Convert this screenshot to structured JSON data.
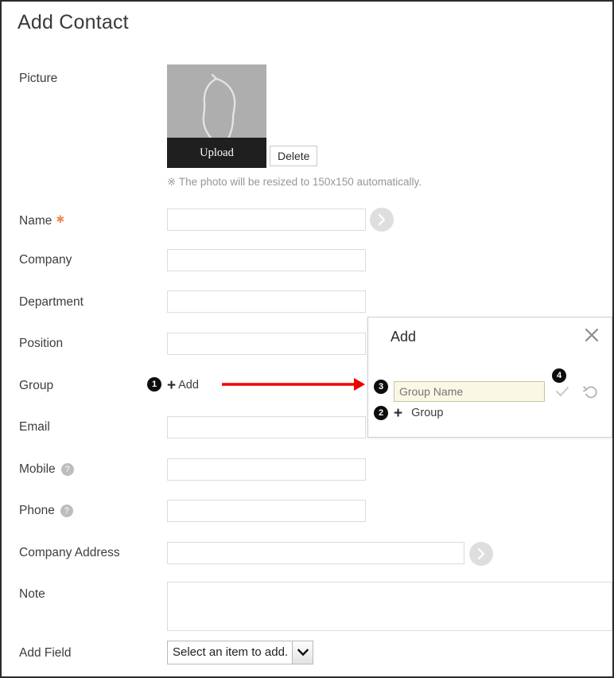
{
  "page": {
    "title": "Add Contact"
  },
  "picture": {
    "label": "Picture",
    "upload_label": "Upload",
    "delete_label": "Delete",
    "note": "※ The photo will be resized to 150x150 automatically."
  },
  "fields": [
    {
      "label": "Name",
      "required": true,
      "value": "",
      "placeholder": ""
    },
    {
      "label": "Company",
      "required": false,
      "value": "",
      "placeholder": ""
    },
    {
      "label": "Department",
      "required": false,
      "value": "",
      "placeholder": ""
    },
    {
      "label": "Position",
      "required": false,
      "value": "",
      "placeholder": ""
    },
    {
      "label": "Group",
      "required": false,
      "value": "",
      "placeholder": ""
    },
    {
      "label": "Email",
      "required": false,
      "value": "",
      "placeholder": ""
    },
    {
      "label": "Mobile",
      "required": false,
      "value": "",
      "placeholder": "",
      "help": true
    },
    {
      "label": "Phone",
      "required": false,
      "value": "",
      "placeholder": "",
      "help": true
    },
    {
      "label": "Company Address",
      "required": false,
      "value": "",
      "placeholder": ""
    },
    {
      "label": "Note",
      "required": false,
      "value": "",
      "placeholder": ""
    },
    {
      "label": "Add Field",
      "required": false,
      "value": "",
      "placeholder": ""
    }
  ],
  "group_row": {
    "add_label": "Add"
  },
  "popup": {
    "title": "Add",
    "close_label": "×",
    "group_name_value": "Group Name",
    "group_name_placeholder": "Group Name",
    "add_group_label": "Group"
  },
  "add_field": {
    "selected_option": "Select an item to add.",
    "options": [
      "Select an item to add."
    ]
  },
  "annotations": {
    "badges": [
      "1",
      "2",
      "3",
      "4"
    ],
    "arrow_color": "#ee0000"
  },
  "colors": {
    "required_star": "#ef8a52",
    "badge_bg": "#0d0d0d",
    "upload_bar": "#1f1f1f",
    "picture_bg": "#aeaeae",
    "input_border": "#dcdcdc",
    "group_input_bg": "#faf8e4",
    "page_border": "#2b2b2b"
  }
}
